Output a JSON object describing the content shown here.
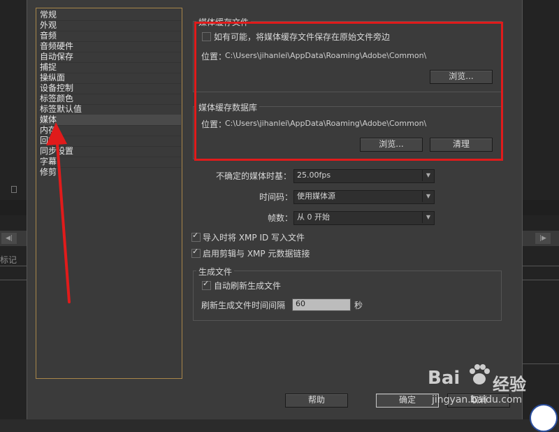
{
  "sidebar": {
    "items": [
      {
        "label": "常规"
      },
      {
        "label": "外观"
      },
      {
        "label": "音频"
      },
      {
        "label": "音频硬件"
      },
      {
        "label": "自动保存"
      },
      {
        "label": "捕捉"
      },
      {
        "label": "操纵面"
      },
      {
        "label": "设备控制"
      },
      {
        "label": "标签颜色"
      },
      {
        "label": "标签默认值"
      },
      {
        "label": "媒体"
      },
      {
        "label": "内存"
      },
      {
        "label": "回放"
      },
      {
        "label": "同步设置"
      },
      {
        "label": "字幕"
      },
      {
        "label": "修剪"
      }
    ],
    "selected_index": 10
  },
  "media_cache_files": {
    "title": "媒体缓存文件",
    "checkbox_label": "如有可能，将媒体缓存文件保存在原始文件旁边",
    "checkbox_checked": false,
    "location_label": "位置：",
    "location_path": "C:\\Users\\jihanlei\\AppData\\Roaming\\Adobe\\Common\\",
    "browse_label": "浏览..."
  },
  "media_cache_db": {
    "title": "媒体缓存数据库",
    "location_label": "位置：",
    "location_path": "C:\\Users\\jihanlei\\AppData\\Roaming\\Adobe\\Common\\",
    "browse_label": "浏览...",
    "clean_label": "清理"
  },
  "settings": {
    "timebase_label": "不确定的媒体时基：",
    "timebase_value": "25.00fps",
    "timecode_label": "时间码：",
    "timecode_value": "使用媒体源",
    "frame_label": "帧数：",
    "frame_value": "从 0 开始",
    "xmp_write_label": "导入时将 XMP ID 写入文件",
    "xmp_write_checked": true,
    "xmp_link_label": "启用剪辑与 XMP 元数据链接",
    "xmp_link_checked": true
  },
  "growing_files": {
    "title": "生成文件",
    "auto_refresh_label": "自动刷新生成文件",
    "auto_refresh_checked": true,
    "interval_label": "刷新生成文件时间间隔",
    "interval_value": "60",
    "interval_unit": "秒"
  },
  "footer": {
    "help_label": "帮助",
    "ok_label": "确定",
    "cancel_label": "取消"
  },
  "background": {
    "left_label": "标记",
    "left_button": "◀|",
    "right_button": "|▶"
  },
  "watermark": {
    "brand": "Bai",
    "brand_suffix": "经验",
    "url": "jingyan.baidu.com"
  },
  "colors": {
    "annotation_red": "#e01b1b",
    "selected_item": "#4a4a4a",
    "list_border": "#a8864a"
  }
}
